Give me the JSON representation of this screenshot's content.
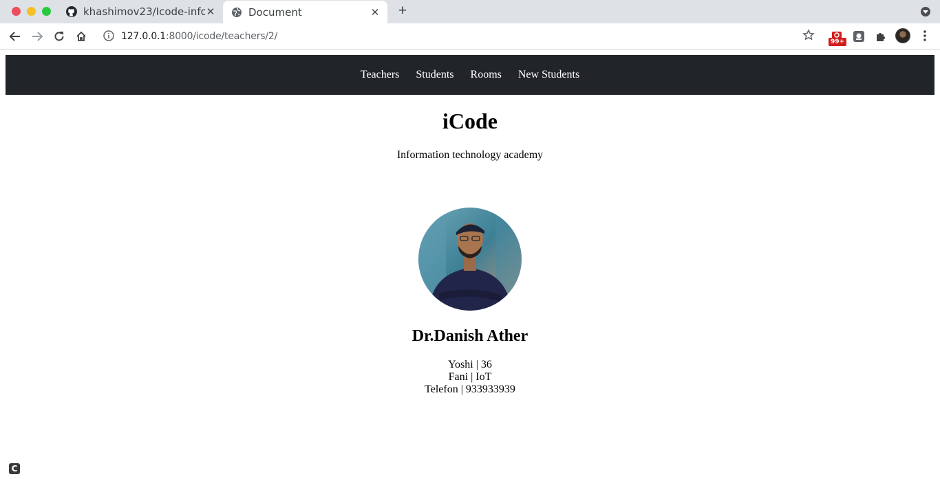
{
  "browser": {
    "tabs": [
      {
        "title": "khashimov23/Icode-info",
        "favicon": "github-icon"
      },
      {
        "title": "Document",
        "favicon": "globe-icon"
      }
    ],
    "url_host": "127.0.0.1",
    "url_path": ":8000/icode/teachers/2/",
    "extension_badge": "99+"
  },
  "nav": {
    "items": [
      "Teachers",
      "Students",
      "Rooms",
      "New Students"
    ]
  },
  "header": {
    "title": "iCode",
    "subtitle": "Information technology academy"
  },
  "teacher": {
    "name": "Dr.Danish Ather",
    "age_line": "Yoshi | 36",
    "subject_line": "Fani | IoT",
    "phone_line": "Telefon | 933933939"
  },
  "corner_icon_letter": "C"
}
